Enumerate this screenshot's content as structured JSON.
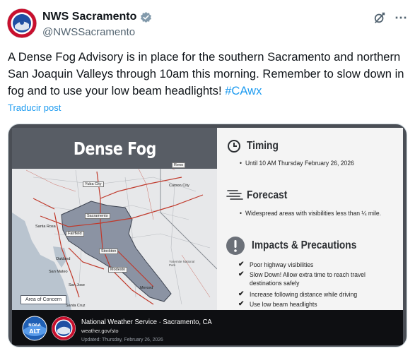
{
  "post": {
    "display_name": "NWS Sacramento",
    "handle": "@NWSSacramento",
    "verified_icon": "verified-badge-icon",
    "text_main": "A Dense Fog Advisory is in place for the southern Sacramento and northern San Joaquin Valleys through 10am this morning. Remember to slow down in fog and to use your low beam headlights! ",
    "hashtag": "#CAwx",
    "translate_label": "Traducir post"
  },
  "colors": {
    "link": "#1d9bf0",
    "advisory_area": "#8b93a3",
    "roads": "#c0392b",
    "footer": "#0e0f12"
  },
  "graphic": {
    "title": "Dense Fog",
    "map_labels": {
      "yuba_city": "Yuba City",
      "reno": "Reno",
      "carson_city": "Carson City",
      "sacramento": "Sacramento",
      "santa_rosa": "Santa Rosa",
      "fairfield": "Fairfield",
      "stockton": "Stockton",
      "oakland": "Oakland",
      "san_mateo": "San Mateo",
      "modesto": "Modesto",
      "yosemite": "Yosemite National Park",
      "san_jose": "San Jose",
      "merced": "Merced",
      "santa_cruz": "Santa Cruz"
    },
    "area_legend": "Area of Concern",
    "timing": {
      "title": "Timing",
      "bullet": "Until 10 AM Thursday February 26, 2026"
    },
    "forecast": {
      "title": "Forecast",
      "bullet": "Widespread areas with visibilities less than ¼ mile."
    },
    "impacts": {
      "title": "Impacts & Precautions",
      "items": [
        "Poor highway visibilities",
        "Slow Down! Allow extra time to reach travel",
        "destinations safely",
        "Increase following distance while driving",
        "Use low beam headlights"
      ]
    },
    "footer": {
      "noaa_badge": "NOAA",
      "alt_text": "ALT",
      "org": "National Weather Service · Sacramento, CA",
      "url": "weather.gov/sto",
      "updated": "Updated: Thursday, February 26, 2026"
    }
  }
}
